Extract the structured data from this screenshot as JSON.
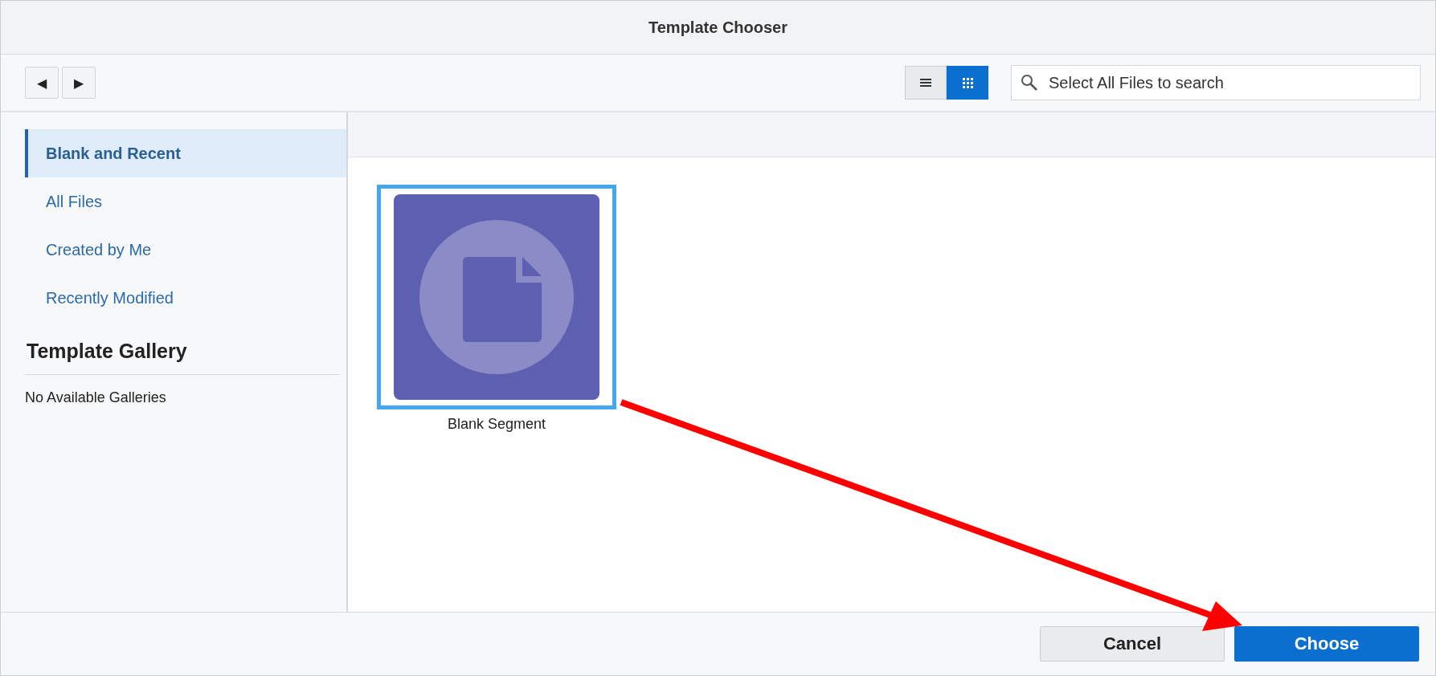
{
  "window": {
    "title": "Template Chooser"
  },
  "toolbar": {
    "nav_buttons": [
      "◀",
      "▶"
    ],
    "views": [
      {
        "kind": "list",
        "selected": false
      },
      {
        "kind": "grid",
        "selected": true
      }
    ],
    "search": {
      "placeholder": "Select All Files to search"
    }
  },
  "sidebar": {
    "items": [
      {
        "label": "Blank and Recent",
        "selected": true
      },
      {
        "label": "All Files",
        "selected": false
      },
      {
        "label": "Created by Me",
        "selected": false
      },
      {
        "label": "Recently Modified",
        "selected": false
      }
    ],
    "gallery": {
      "heading": "Template Gallery",
      "empty_text": "No Available Galleries"
    }
  },
  "templates": [
    {
      "label": "Blank Segment",
      "selected": true
    }
  ],
  "buttons": [
    {
      "label": "Cancel",
      "kind": "secondary"
    },
    {
      "label": "Choose",
      "kind": "primary"
    }
  ]
}
